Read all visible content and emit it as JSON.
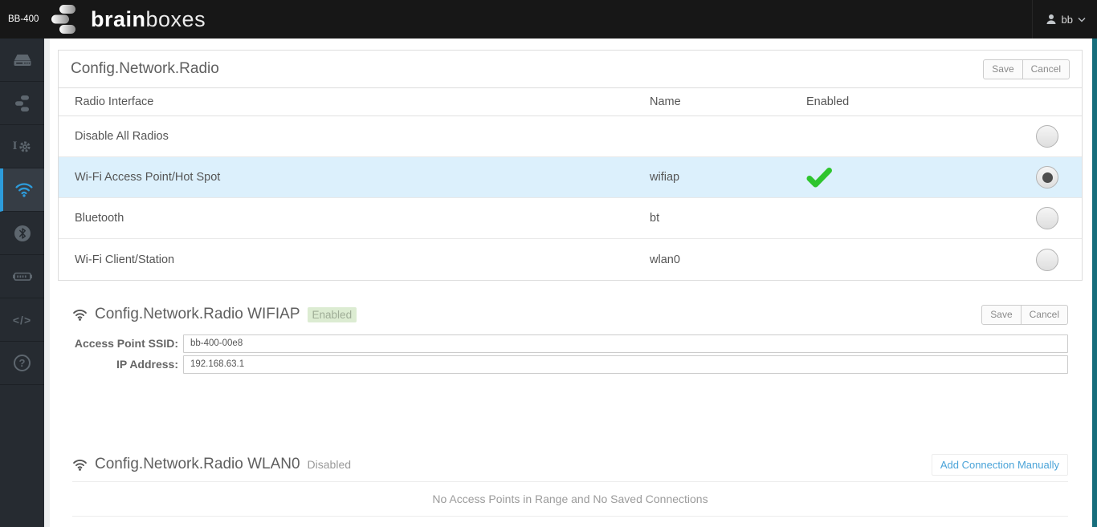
{
  "header": {
    "device_label": "BB-400",
    "brand_bold": "brain",
    "brand_light": "boxes",
    "user_name": "bb"
  },
  "sidebar": {
    "items": [
      {
        "icon": "device"
      },
      {
        "icon": "network-nodes"
      },
      {
        "icon": "io-settings",
        "io_label": "I"
      },
      {
        "icon": "wifi",
        "active": true
      },
      {
        "icon": "bluetooth"
      },
      {
        "icon": "serial-port"
      },
      {
        "icon": "code",
        "glyph": "</>"
      },
      {
        "icon": "help",
        "glyph": "?"
      }
    ],
    "io_label": "I",
    "code_glyph": "</>",
    "help_glyph": "?"
  },
  "radio_panel": {
    "title": "Config.Network.Radio",
    "save_label": "Save",
    "cancel_label": "Cancel",
    "columns": [
      "Radio Interface",
      "Name",
      "Enabled"
    ],
    "rows": [
      {
        "interface": "Disable All Radios",
        "name": "",
        "enabled": false,
        "selected": false
      },
      {
        "interface": "Wi-Fi Access Point/Hot Spot",
        "name": "wifiap",
        "enabled": true,
        "selected": true
      },
      {
        "interface": "Bluetooth",
        "name": "bt",
        "enabled": false,
        "selected": false
      },
      {
        "interface": "Wi-Fi Client/Station",
        "name": "wlan0",
        "enabled": false,
        "selected": false
      }
    ]
  },
  "wifiap_section": {
    "title": "Config.Network.Radio WIFIAP",
    "status_badge": "Enabled",
    "save_label": "Save",
    "cancel_label": "Cancel",
    "fields": [
      {
        "label": "Access Point SSID:",
        "value": "bb-400-00e8"
      },
      {
        "label": "IP Address:",
        "value": "192.168.63.1"
      }
    ]
  },
  "wlan0_section": {
    "title": "Config.Network.Radio WLAN0",
    "status_text": "Disabled",
    "add_connection_label": "Add Connection Manually",
    "empty_message": "No Access Points in Range and No Saved Connections"
  },
  "colors": {
    "accent_blue": "#2d9cdb",
    "check_green": "#2ec52e",
    "scrollbar_teal": "#176e7c",
    "selected_row_bg": "#dcf0fc",
    "badge_bg": "#dcecd2"
  }
}
